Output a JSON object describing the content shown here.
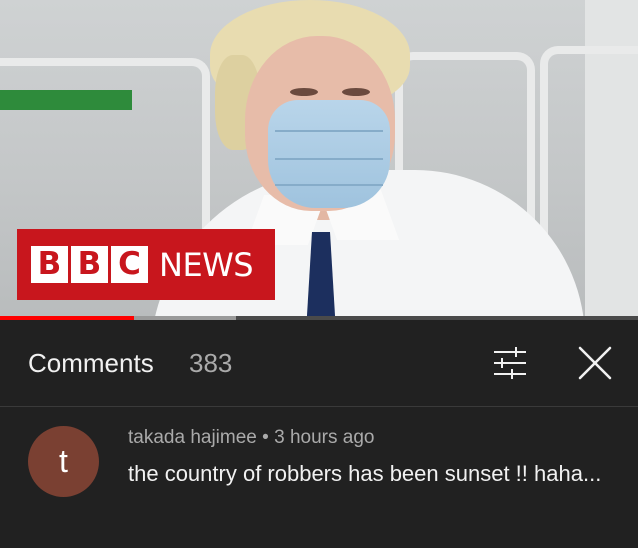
{
  "video": {
    "logo": {
      "letters": [
        "B",
        "B",
        "C"
      ],
      "wordmark": "NEWS",
      "brand_color": "#c8161d"
    },
    "progress": {
      "played_fraction": 0.21,
      "buffered_fraction": 0.37,
      "played_color": "#ff0000"
    }
  },
  "comments_panel": {
    "title": "Comments",
    "count": "383",
    "filter_icon": "filter-sliders-icon",
    "close_icon": "close-icon"
  },
  "comments": [
    {
      "avatar_initial": "t",
      "avatar_color": "#7a4032",
      "author": "takada hajimee",
      "separator": " • ",
      "time": "3 hours ago",
      "text": "the country of robbers has been sunset !! haha..."
    }
  ]
}
